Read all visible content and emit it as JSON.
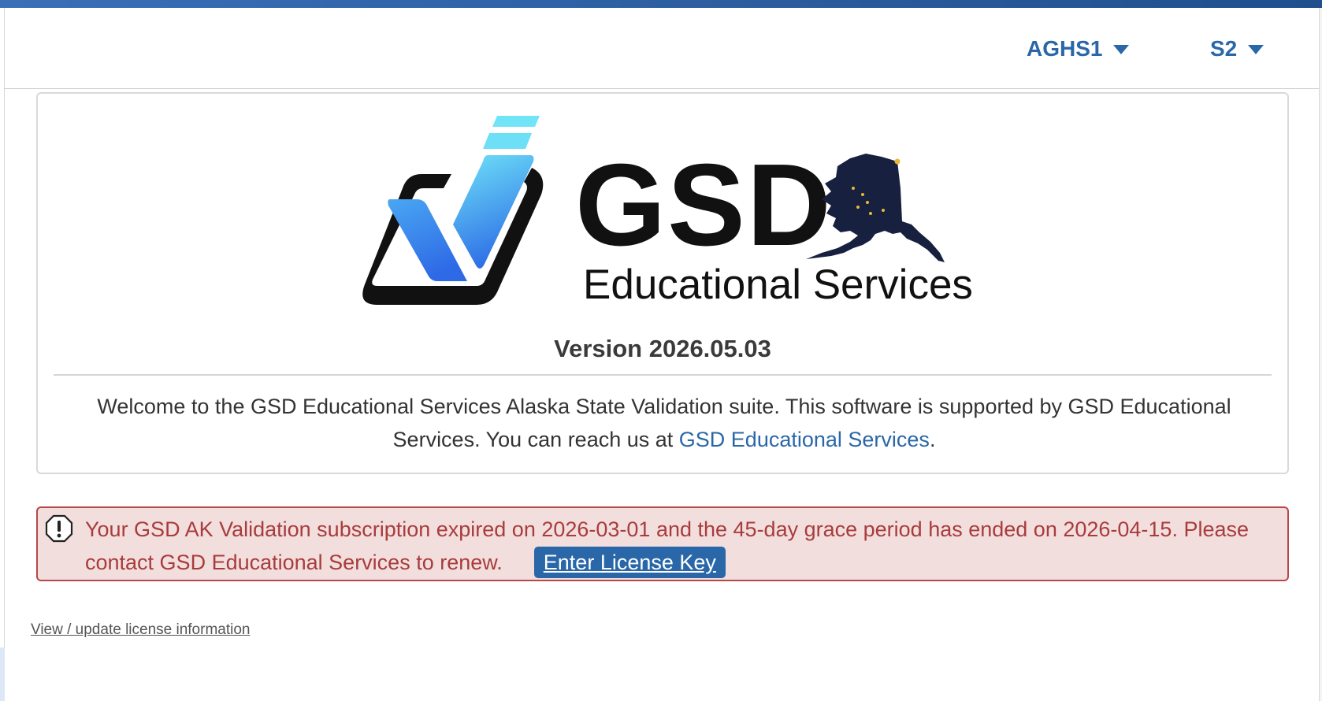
{
  "header": {
    "school_dropdown": {
      "value": "AGHS1"
    },
    "term_dropdown": {
      "value": "S2"
    }
  },
  "brand": {
    "name": "GSD",
    "tagline": "Educational Services"
  },
  "card": {
    "version": "Version 2026.05.03",
    "welcome_text": "Welcome to the GSD Educational Services Alaska State Validation suite. This software is supported by GSD Educational Services. You can reach us at ",
    "welcome_link": "GSD Educational Services",
    "welcome_end": "."
  },
  "alert": {
    "message": "Your GSD AK Validation subscription expired on 2026-03-01 and the 45-day grace period has ended on 2026-04-15. Please contact GSD Educational Services to renew.",
    "button_label": "Enter License Key"
  },
  "footer": {
    "license_link": "View / update license information"
  },
  "colors": {
    "accent": "#2a67a8",
    "alert_text": "#a83c3c",
    "alert_bg": "#f3dede",
    "alaska_navy": "#17213f",
    "star_gold": "#e8b83a"
  }
}
